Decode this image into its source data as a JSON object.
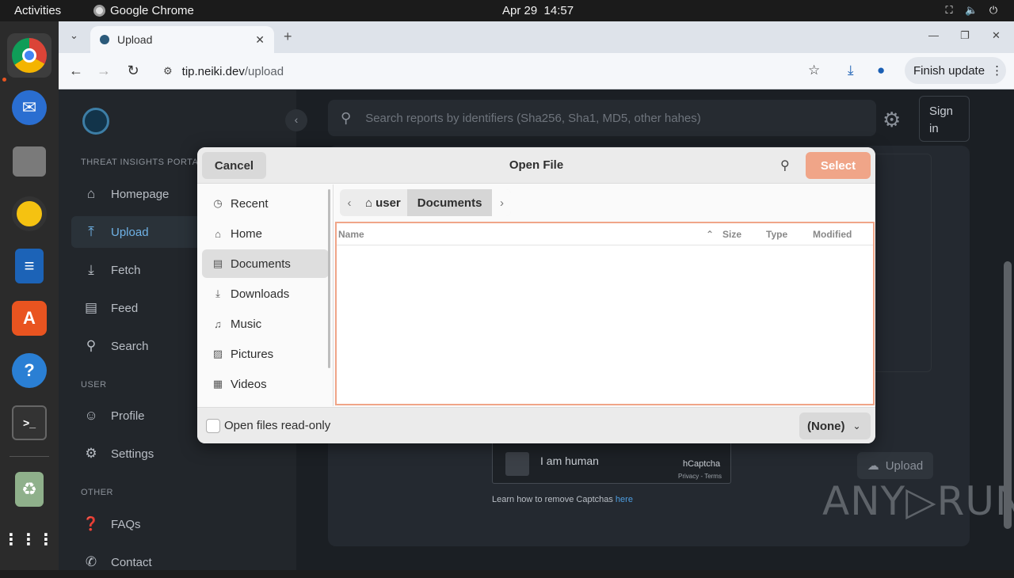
{
  "topbar": {
    "activities": "Activities",
    "app_name": "Google Chrome",
    "date": "Apr 29",
    "time": "14:57"
  },
  "dock": {
    "items": [
      "chrome-icon",
      "thunderbird-icon",
      "files-icon",
      "rhythmbox-icon",
      "writer-icon",
      "app-center-icon",
      "help-icon",
      "terminal-icon",
      "trash-icon",
      "app-grid-icon"
    ]
  },
  "browser": {
    "tab_title": "Upload",
    "url_host": "tip.neiki.dev",
    "url_path": "/upload",
    "finish_update": "Finish update"
  },
  "page": {
    "sidebar": {
      "section_portal": "THREAT INSIGHTS PORTAL",
      "nav": [
        {
          "label": "Homepage",
          "icon": "home-icon"
        },
        {
          "label": "Upload",
          "icon": "upload-icon"
        },
        {
          "label": "Fetch",
          "icon": "fetch-icon"
        },
        {
          "label": "Feed",
          "icon": "feed-icon"
        },
        {
          "label": "Search",
          "icon": "search-icon"
        }
      ],
      "section_user": "USER",
      "user_nav": [
        {
          "label": "Profile",
          "icon": "profile-icon"
        },
        {
          "label": "Settings",
          "icon": "settings-icon"
        }
      ],
      "section_other": "OTHER",
      "other_nav": [
        {
          "label": "FAQs",
          "icon": "faq-icon"
        },
        {
          "label": "Contact",
          "icon": "contact-icon"
        }
      ]
    },
    "search_placeholder": "Search reports by identifiers (Sha256, Sha1, MD5, other hahes)",
    "sign_in": "Sign in",
    "captcha": {
      "label": "I am human",
      "brand": "hCaptcha",
      "terms": "Privacy - Terms",
      "note": "Learn how to remove Captchas ",
      "note_link": "here"
    },
    "upload_button": "Upload",
    "watermark": "ANY▷RUN"
  },
  "dialog": {
    "title": "Open File",
    "cancel": "Cancel",
    "select": "Select",
    "places": [
      {
        "label": "Recent",
        "icon": "clock-icon"
      },
      {
        "label": "Home",
        "icon": "home-icon"
      },
      {
        "label": "Documents",
        "icon": "document-icon"
      },
      {
        "label": "Downloads",
        "icon": "download-icon"
      },
      {
        "label": "Music",
        "icon": "music-icon"
      },
      {
        "label": "Pictures",
        "icon": "picture-icon"
      },
      {
        "label": "Videos",
        "icon": "video-icon"
      }
    ],
    "path": [
      "user",
      "Documents"
    ],
    "columns": {
      "name": "Name",
      "size": "Size",
      "type": "Type",
      "modified": "Modified"
    },
    "read_only_label": "Open files read-only",
    "filter": "(None)"
  }
}
